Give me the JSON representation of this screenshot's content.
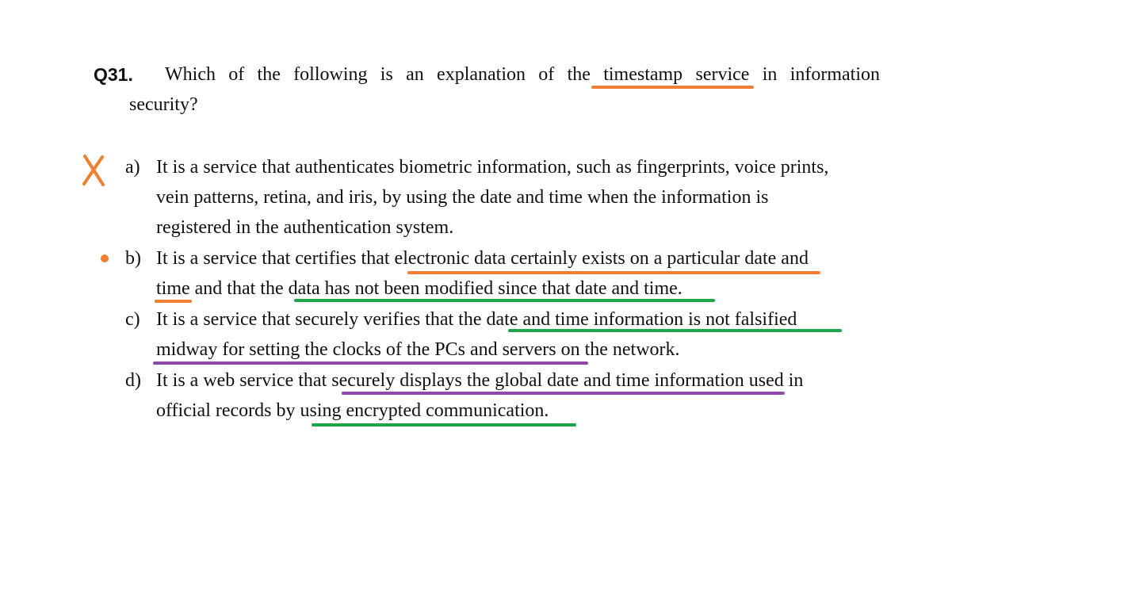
{
  "question": {
    "number": "Q31.",
    "line1": "Which of the following is an explanation of the timestamp service in information",
    "line2": "security?"
  },
  "options": [
    {
      "letter": "a)",
      "lines": [
        "It is a service that authenticates biometric information, such as fingerprints, voice prints,",
        "vein patterns, retina, and iris, by using the date and time when the information is",
        "registered in the authentication system."
      ]
    },
    {
      "letter": "b)",
      "lines": [
        "It is a service that certifies that electronic data certainly exists on a particular date and",
        "time and that the data has not been modified since that date and time."
      ]
    },
    {
      "letter": "c)",
      "lines": [
        "It is a service that securely verifies that the date and time information is not falsified",
        "midway for setting the clocks of the PCs and servers on the network."
      ]
    },
    {
      "letter": "d)",
      "lines": [
        "It is a web service that securely displays the global date and time information used in",
        "official records by using encrypted communication."
      ]
    }
  ],
  "annotations": {
    "wrong_mark": "x-mark-icon",
    "selected_mark": "dot-icon",
    "colors": {
      "orange": "#f07f33",
      "green": "#1fa64a",
      "purple": "#8f49a6"
    }
  }
}
